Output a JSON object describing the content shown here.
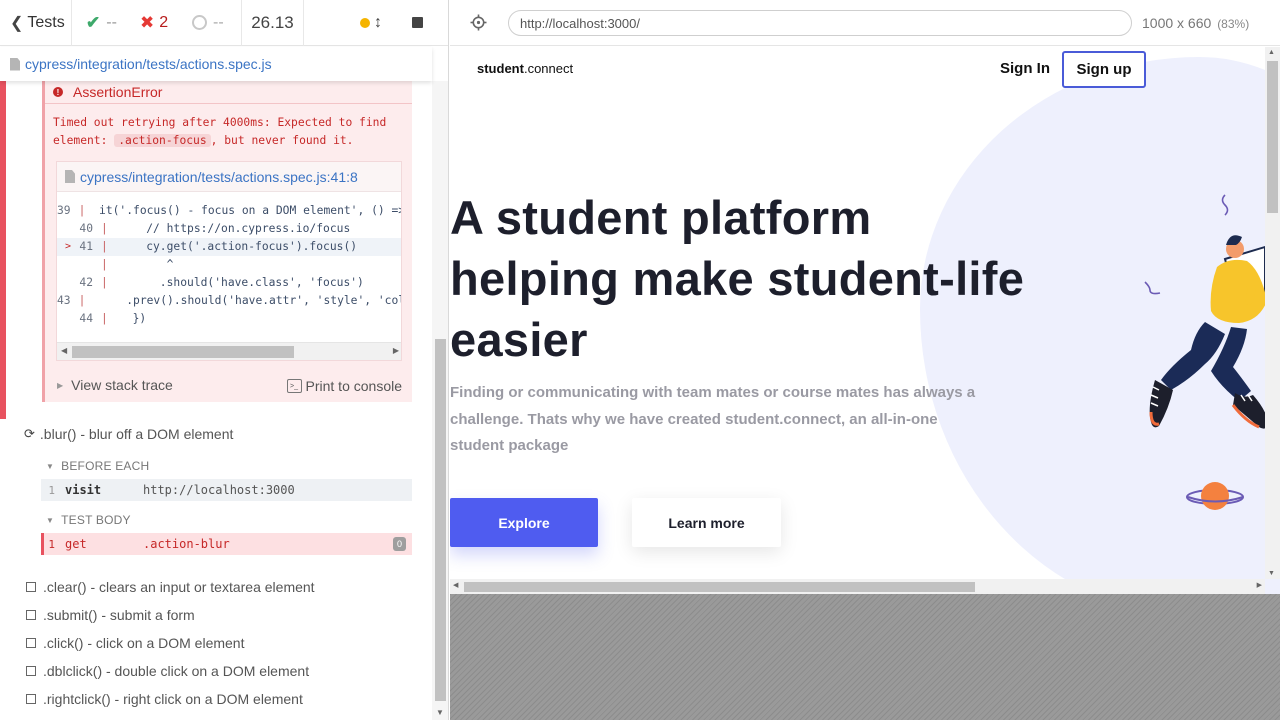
{
  "reporter": {
    "tests_label": "Tests",
    "passed": "--",
    "failed": "2",
    "pending": "--",
    "duration": "26.13",
    "spec_path": "cypress/integration/tests/actions.spec.js",
    "error": {
      "title": "AssertionError",
      "message_part1": "Timed out retrying after 4000ms: Expected to find element:",
      "message_code": ".action-focus",
      "message_part2": ", but never found it.",
      "code_file": "cypress/integration/tests/actions.spec.js:41:8",
      "code_lines": [
        {
          "marker": "",
          "num": "39",
          "text": "  it('.focus() - focus on a DOM element', () => {"
        },
        {
          "marker": "",
          "num": "40",
          "text": "    // https://on.cypress.io/focus"
        },
        {
          "marker": ">",
          "num": "41",
          "text": "    cy.get('.action-focus').focus()"
        },
        {
          "marker": "",
          "num": "",
          "text": "       ^"
        },
        {
          "marker": "",
          "num": "42",
          "text": "      .should('have.class', 'focus')"
        },
        {
          "marker": "",
          "num": "43",
          "text": "      .prev().should('have.attr', 'style', 'color: orange;')"
        },
        {
          "marker": "",
          "num": "44",
          "text": "  })"
        }
      ],
      "stack_trace_label": "View stack trace",
      "print_console_label": "Print to console"
    },
    "current_test": ".blur() - blur off a DOM element",
    "hooks": {
      "before_each_label": "BEFORE EACH",
      "test_body_label": "TEST BODY",
      "visit": {
        "num": "1",
        "name": "visit",
        "message": "http://localhost:3000"
      },
      "get": {
        "num": "1",
        "name": "get",
        "message": ".action-blur",
        "badge": "0"
      }
    },
    "tests": [
      ".clear() - clears an input or textarea element",
      ".submit() - submit a form",
      ".click() - click on a DOM element",
      ".dblclick() - double click on a DOM element",
      ".rightclick() - right click on a DOM element"
    ]
  },
  "runner": {
    "url": "http://localhost:3000/",
    "viewport": "1000 x 660",
    "scale": "(83%)"
  },
  "site": {
    "logo_bold": "student",
    "logo_rest": ".connect",
    "signin": "Sign In",
    "signup": "Sign up",
    "hero_title": "A student platform helping make student-life easier",
    "hero_subtitle": "Finding or communicating with team mates or course mates has always a challenge. Thats why we have created student.connect, an all-in-one student package",
    "explore": "Explore",
    "learn_more": "Learn more"
  },
  "colors": {
    "accent": "#4f5cf0",
    "fail": "#e8525f",
    "pass": "#3ea96b",
    "running": "#f5b400"
  }
}
